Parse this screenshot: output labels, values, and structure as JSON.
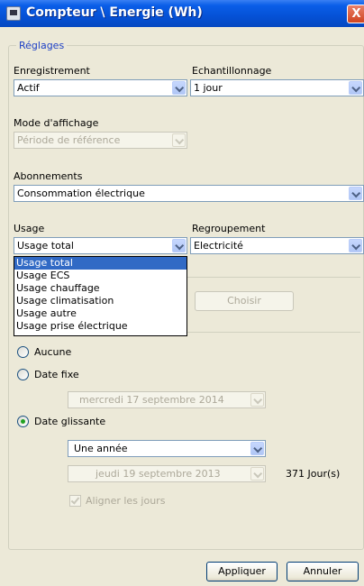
{
  "window": {
    "title": "Compteur \\ Energie (Wh)",
    "close_label": "X"
  },
  "reglages": {
    "legend": "Réglages",
    "enregistrement": {
      "label": "Enregistrement",
      "value": "Actif"
    },
    "echantillonnage": {
      "label": "Echantillonnage",
      "value": "1 jour"
    },
    "mode_affichage": {
      "label": "Mode d'affichage",
      "value": "Période de référence",
      "disabled": true
    },
    "abonnements": {
      "label": "Abonnements",
      "value": "Consommation électrique"
    },
    "usage": {
      "label": "Usage",
      "value": "Usage total",
      "options": [
        "Usage total",
        "Usage ECS",
        "Usage chauffage",
        "Usage climatisation",
        "Usage autre",
        "Usage prise électrique"
      ],
      "selected_index": 0
    },
    "regroupement": {
      "label": "Regroupement",
      "value": "Electricité"
    },
    "choisir_label": "Choisir"
  },
  "periode": {
    "aucune_label": "Aucune",
    "date_fixe_label": "Date fixe",
    "date_fixe_value": "mercredi  17 septembre 2014",
    "date_glissante_label": "Date glissante",
    "duree_value": "Une année",
    "date_debut_value": "jeudi   19 septembre 2013",
    "jours_label": "371 Jour(s)",
    "aligner_label": "Aligner les jours",
    "selected": "date_glissante"
  },
  "footer": {
    "appliquer_label": "Appliquer",
    "annuler_label": "Annuler"
  },
  "colors": {
    "titlebar": "#0a5ee8",
    "legend": "#1c3fc5",
    "selection": "#316ac5",
    "radio_dot": "#21a121"
  }
}
